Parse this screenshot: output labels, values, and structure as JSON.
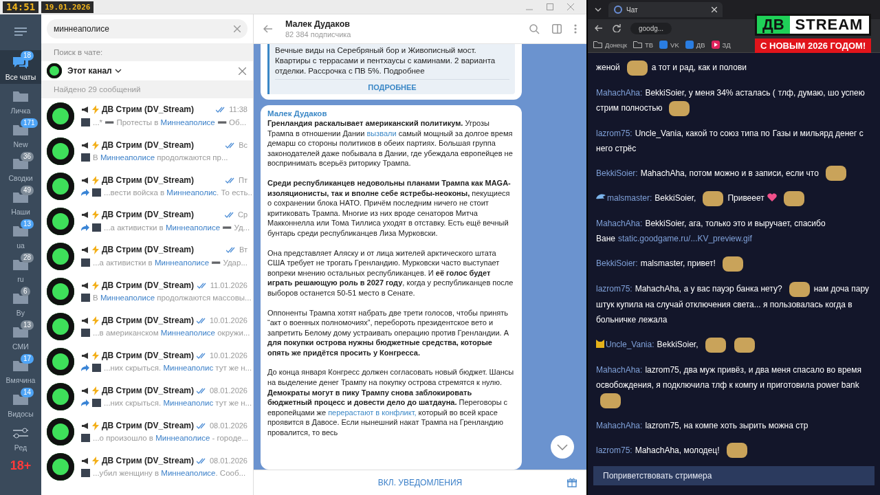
{
  "overlay": {
    "clock": "14:51",
    "date": "19.01.2026",
    "age_badge": "18+",
    "logo_left": "ДВ",
    "logo_right": "STREAM",
    "banner": "С НОВЫМ 2026 ГОДОМ!"
  },
  "folders": [
    {
      "kind": "chats",
      "label": "Все чаты",
      "badge": "18",
      "muted": false,
      "selected": true
    },
    {
      "kind": "folder",
      "label": "Личка",
      "selected": false
    },
    {
      "kind": "folder",
      "label": "New",
      "badge": "171",
      "muted": false,
      "selected": false
    },
    {
      "kind": "folder",
      "label": "Сводки",
      "badge": "36",
      "muted": true,
      "selected": false
    },
    {
      "kind": "folder",
      "label": "Наши",
      "badge": "49",
      "muted": true,
      "selected": false
    },
    {
      "kind": "folder",
      "label": "ua",
      "badge": "13",
      "muted": false,
      "selected": false
    },
    {
      "kind": "folder",
      "label": "ru",
      "badge": "28",
      "muted": true,
      "selected": false
    },
    {
      "kind": "folder",
      "label": "By",
      "badge": "6",
      "muted": true,
      "selected": false
    },
    {
      "kind": "folder",
      "label": "СМИ",
      "badge": "13",
      "muted": true,
      "selected": false
    },
    {
      "kind": "folder",
      "label": "Вмячина",
      "badge": "17",
      "muted": false,
      "selected": false
    },
    {
      "kind": "folder",
      "label": "Видосы",
      "badge": "14",
      "muted": false,
      "selected": false
    },
    {
      "kind": "edit",
      "label": "Ред",
      "selected": false
    }
  ],
  "search": {
    "value": "миннеаполисе",
    "scope_label": "Поиск в чате:",
    "scope": "Этот канал",
    "found": "Найдено 29 сообщений"
  },
  "results": [
    {
      "name": "ДВ Стрим (DV_Stream)",
      "time": "11:38",
      "forwarded": false,
      "before": "...* ➖ Протесты в ",
      "match": "Миннеаполисе",
      "after": " ➖ Об..."
    },
    {
      "name": "ДВ Стрим (DV_Stream)",
      "time": "Вс",
      "forwarded": false,
      "before": "В ",
      "match": "Миннеаполисе",
      "after": " продолжаются пр..."
    },
    {
      "name": "ДВ Стрим (DV_Stream)",
      "time": "Пт",
      "forwarded": true,
      "before": "...вести войска в ",
      "match": "Миннеаполис",
      "after": ". То есть..."
    },
    {
      "name": "ДВ Стрим (DV_Stream)",
      "time": "Ср",
      "forwarded": true,
      "before": "...а активистки в ",
      "match": "Миннеаполисе",
      "after": " ➖ Уд..."
    },
    {
      "name": "ДВ Стрим (DV_Stream)",
      "time": "Вт",
      "forwarded": false,
      "before": "...а активистки в ",
      "match": "Миннеаполисе",
      "after": " ➖ Удар..."
    },
    {
      "name": "ДВ Стрим (DV_Stream)",
      "time": "11.01.2026",
      "forwarded": false,
      "before": "В ",
      "match": "Миннеаполисе",
      "after": " продолжаются массовы..."
    },
    {
      "name": "ДВ Стрим (DV_Stream)",
      "time": "10.01.2026",
      "forwarded": false,
      "before": "...в американском ",
      "match": "Миннеаполисе",
      "after": " окружи..."
    },
    {
      "name": "ДВ Стрим (DV_Stream)",
      "time": "10.01.2026",
      "forwarded": true,
      "before": "...них скрыться. ",
      "match": "Миннеаполис",
      "after": " тут же н..."
    },
    {
      "name": "ДВ Стрим (DV_Stream)",
      "time": "08.01.2026",
      "forwarded": true,
      "before": "...них скрыться. ",
      "match": "Миннеаполис",
      "after": " тут же н..."
    },
    {
      "name": "ДВ Стрим (DV_Stream)",
      "time": "08.01.2026",
      "forwarded": false,
      "before": "...о произошло в ",
      "match": "Миннеаполисе",
      "after": " - городе..."
    },
    {
      "name": "ДВ Стрим (DV_Stream)",
      "time": "08.01.2026",
      "forwarded": false,
      "before": "...убил женщину в ",
      "match": "Миннеаполисе",
      "after": ". Сооб..."
    }
  ],
  "chat": {
    "title": "Малек Дудаков",
    "subtitle": "82 384 подписчика",
    "ad": {
      "text": "Вечные виды на Серебряный бор и Живописный мост. Квартиры с террасами и пентхаусы с каминами. 2 варианта отделки. Рассрочка с ПВ 5%. Подробнее",
      "button": "ПОДРОБНЕЕ"
    },
    "post": {
      "author": "Малек Дудаков",
      "paragraphs": [
        [
          {
            "kind": "text",
            "text": "**Гренландия раскалывает американский политикум.** Угрозы Трампа в отношении Дании "
          },
          {
            "kind": "link",
            "text": "вызвали"
          },
          {
            "kind": "text",
            "text": " самый мощный за долгое время демарш со стороны политиков в обеих партиях. Большая группа законодателей даже побывала в Дании, где убеждала европейцев не воспринимать всерьёз риторику Трампа."
          }
        ],
        [
          {
            "kind": "text",
            "text": "**Среди республиканцев недовольны планами Трампа как MAGA-изоляционисты, так и вполне себе ястребы-неоконы,** пекущиеся о сохранении блока НАТО. Причём последним ничего не стоит критиковать Трампа. Многие из них вроде сенаторов Митча Макконнелла или Тома Тиллиса уходят в отставку. Есть ещё вечный бунтарь среди республиканцев Лиза Мурковски."
          }
        ],
        [
          {
            "kind": "text",
            "text": "Она представляет Аляску и от лица жителей арктического штата США требует не трогать Гренландию. Мурковски часто выступает вопреки мнению остальных республиканцев. И **её голос будет играть решающую роль в 2027 году**, когда у республиканцев после выборов останется 50-51 место в Сенате."
          }
        ],
        [
          {
            "kind": "text",
            "text": "Оппоненты Трампа хотят набрать две трети голосов, чтобы принять “акт о военных полномочиях”, перебороть президентское вето и запретить Белому дому устраивать операцию против Гренландии. А **для покупки острова нужны бюджетные средства, которые опять же придётся просить у Конгресса.**"
          }
        ],
        [
          {
            "kind": "text",
            "text": "До конца января Конгресс должен согласовать новый бюджет. Шансы на выделение денег Трампу на покупку острова стремятся к нулю. **Демократы могут в пику Трампу снова заблокировать бюджетный процесс и довести дело до шатдауна.** Переговоры с европейцами же "
          },
          {
            "kind": "link",
            "text": "перерастают в конфликт,"
          },
          {
            "kind": "text",
            "text": " который во всей красе проявится в Давосе. Если нынешний накат Трампа на Гренландию провалится, то весь"
          }
        ]
      ]
    },
    "bottom_button": "ВКЛ. УВЕДОМЛЕНИЯ"
  },
  "browser": {
    "tab": "Чат",
    "address": "goodg...",
    "bookmarks": [
      {
        "kind": "folder",
        "label": "Донецк"
      },
      {
        "kind": "folder",
        "label": "ТВ"
      },
      {
        "kind": "vk",
        "label": "VK"
      },
      {
        "kind": "vk",
        "label": "ДВ"
      },
      {
        "kind": "video",
        "label": "ЗД"
      }
    ]
  },
  "stream_chat": {
    "messages": [
      {
        "kind": "plain",
        "parts": [
          {
            "kind": "text",
            "text": "женой"
          },
          {
            "kind": "emote"
          },
          {
            "kind": "text",
            "text": "а тот и рад, как и полови"
          }
        ]
      },
      {
        "kind": "plain",
        "user": "MahachAha:",
        "parts": [
          {
            "kind": "text",
            "text": "BekkiSoier, у меня 34% асталась ("
          },
          {
            "kind": "text",
            "text": "тлф, думаю, шо успею стрим полностью"
          },
          {
            "kind": "emote"
          }
        ]
      },
      {
        "kind": "plain",
        "user": "lazrom75:",
        "parts": [
          {
            "kind": "text",
            "text": "Uncle_Vania, какой то союз типа по"
          },
          {
            "kind": "text",
            "text": "Газы и мильярд денег с него стрёс"
          }
        ]
      },
      {
        "kind": "plain",
        "user": "BekkiSoier:",
        "parts": [
          {
            "kind": "text",
            "text": "MahachAha, потом можно и в записи, если что"
          },
          {
            "kind": "emote"
          }
        ]
      },
      {
        "kind": "bird",
        "user": "malsmaster:",
        "parts": [
          {
            "kind": "text",
            "text": "BekkiSoier,"
          },
          {
            "kind": "emote"
          },
          {
            "kind": "text",
            "text": "Привееет"
          },
          {
            "kind": "heart"
          },
          {
            "kind": "emote"
          }
        ]
      },
      {
        "kind": "plain",
        "user": "MahachAha:",
        "parts": [
          {
            "kind": "text",
            "text": "BekkiSoier, ага, только это и выручает, спасибо Ване"
          },
          {
            "kind": "link",
            "text": "static.goodgame.ru/...KV_preview.gif"
          }
        ]
      },
      {
        "kind": "plain",
        "user": "BekkiSoier:",
        "parts": [
          {
            "kind": "text",
            "text": "malsmaster, привет!"
          },
          {
            "kind": "emote"
          }
        ]
      },
      {
        "kind": "plain",
        "user": "lazrom75:",
        "parts": [
          {
            "kind": "text",
            "text": "MahachAha, а у вас пауэр банка нету?"
          },
          {
            "kind": "emote"
          },
          {
            "kind": "text",
            "text": "нам доча пару штук купила на случай отключения света... я пользовалась когда в больничке лежала"
          }
        ]
      },
      {
        "kind": "cat",
        "user": "Uncle_Vania:",
        "parts": [
          {
            "kind": "text",
            "text": "BekkiSoier,"
          },
          {
            "kind": "emote"
          },
          {
            "kind": "emote"
          }
        ]
      },
      {
        "kind": "plain",
        "user": "MahachAha:",
        "parts": [
          {
            "kind": "text",
            "text": "lazrom75, два муж привёз, и два меня спасало во время освобождения, я подключила тлф к компу и приготовила power bank"
          },
          {
            "kind": "emote"
          }
        ]
      },
      {
        "kind": "plain",
        "user": "MahachAha:",
        "parts": [
          {
            "kind": "text",
            "text": "lazrom75, на компе хоть зырить можна стр"
          }
        ]
      },
      {
        "kind": "plain",
        "user": "lazrom75:",
        "parts": [
          {
            "kind": "text",
            "text": "MahachAha, молодец!"
          },
          {
            "kind": "emote"
          }
        ]
      }
    ],
    "greet_button": "Поприветствовать стримера"
  }
}
